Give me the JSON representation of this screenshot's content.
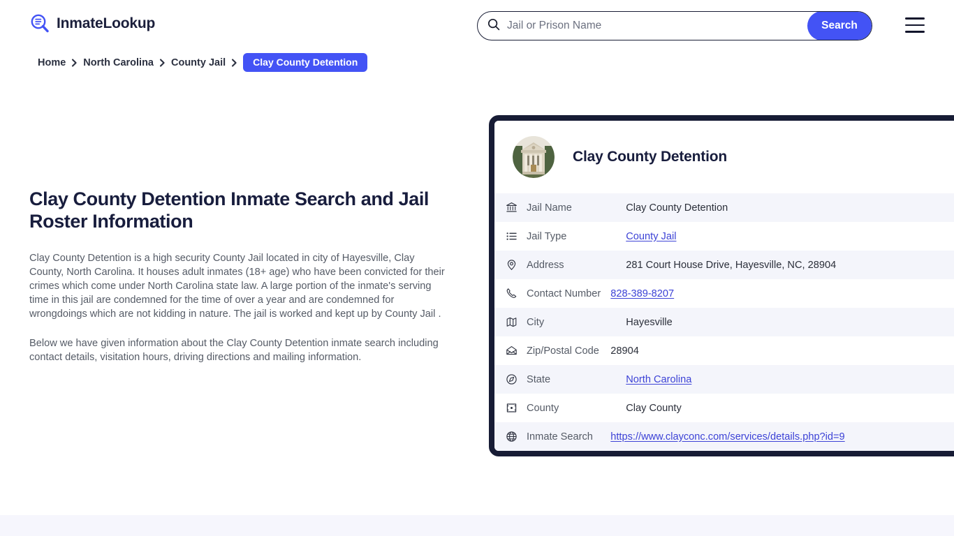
{
  "header": {
    "brand_name": "InmateLookup",
    "logo_icon": "magnifier-list-icon",
    "menu_icon": "hamburger-menu-icon",
    "accent_color": "#4353f5",
    "dark_color": "#171c35"
  },
  "search": {
    "icon": "search-icon",
    "placeholder": "Jail or Prison Name",
    "value": "",
    "button_label": "Search"
  },
  "breadcrumb": {
    "items": [
      {
        "label": "Home",
        "current": false
      },
      {
        "label": "North Carolina",
        "current": false
      },
      {
        "label": "County Jail",
        "current": false
      }
    ],
    "current": "Clay County Detention",
    "separator_icon": "chevron-right-icon"
  },
  "main": {
    "title": "Clay County Detention Inmate Search and Jail Roster Information",
    "paragraphs": [
      "Clay County Detention is a high security County Jail located in city of Hayesville, Clay County, North Carolina. It houses adult inmates (18+ age) who have been convicted for their crimes which come under North Carolina state law. A large portion of the inmate's serving time in this jail are condemned for the time of over a year and are condemned for wrongdoings which are not kidding in nature. The jail is worked and kept up by County Jail .",
      "Below we have given information about the Clay County Detention inmate search including contact details, visitation hours, driving directions and mailing information."
    ]
  },
  "card": {
    "avatar_icon": "courthouse-photo",
    "title": "Clay County Detention",
    "rows": [
      {
        "icon": "bank-icon",
        "label": "Jail Name",
        "value": "Clay County Detention",
        "link": false
      },
      {
        "icon": "list-icon",
        "label": "Jail Type",
        "value": "County Jail",
        "link": true
      },
      {
        "icon": "map-pin-icon",
        "label": "Address",
        "value": "281 Court House Drive, Hayesville, NC, 28904",
        "link": false
      },
      {
        "icon": "phone-icon",
        "label": "Contact Number",
        "value": "828-389-8207",
        "link": true
      },
      {
        "icon": "map-icon",
        "label": "City",
        "value": "Hayesville",
        "link": false
      },
      {
        "icon": "envelope-icon",
        "label": "Zip/Postal Code",
        "value": "28904",
        "link": false
      },
      {
        "icon": "compass-icon",
        "label": "State",
        "value": "North Carolina",
        "link": true
      },
      {
        "icon": "county-icon",
        "label": "County",
        "value": "Clay County",
        "link": false
      },
      {
        "icon": "globe-icon",
        "label": "Inmate Search",
        "value": "https://www.clayconc.com/services/details.php?id=9",
        "link": true
      }
    ]
  }
}
